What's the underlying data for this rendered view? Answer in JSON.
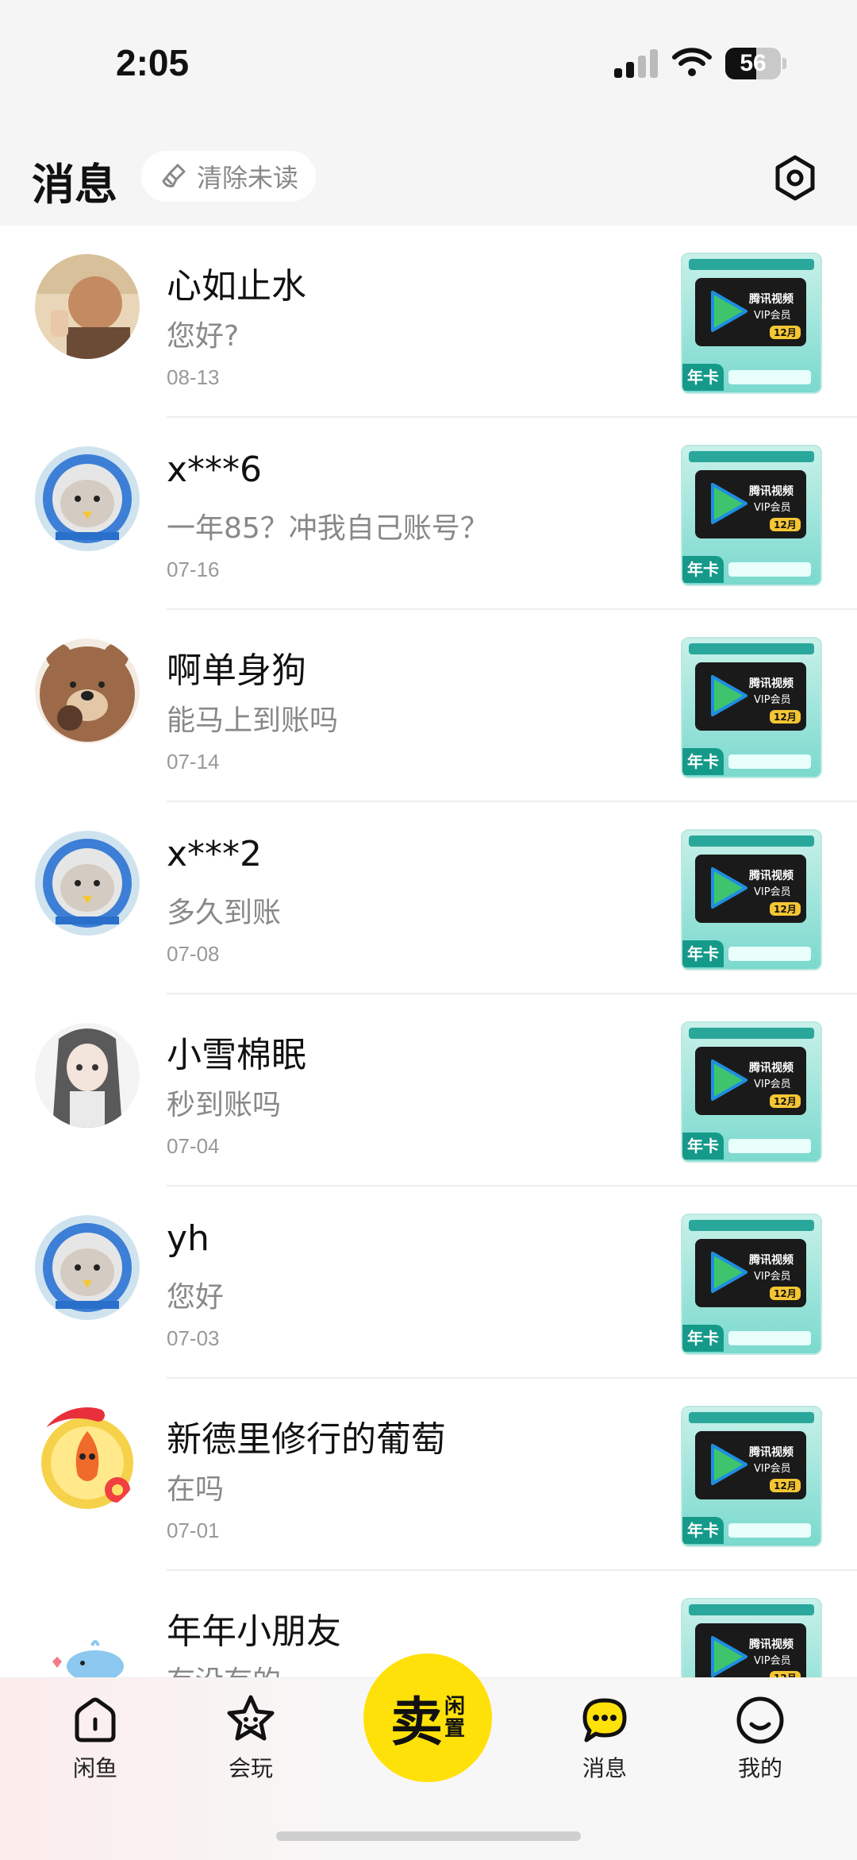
{
  "status_bar": {
    "time": "2:05",
    "battery": "56",
    "battery_level": 0.56
  },
  "header": {
    "title": "消息",
    "clear_unread_label": "清除未读"
  },
  "conversations": [
    {
      "name": "心如止水",
      "preview": "您好?",
      "date": "08-13",
      "avatar": "person-photo"
    },
    {
      "name": "x***6",
      "preview": "一年85？冲我自己账号？",
      "date": "07-16",
      "avatar": "cat-astronaut"
    },
    {
      "name": "啊单身狗",
      "preview": "能马上到账吗",
      "date": "07-14",
      "avatar": "brown-bear"
    },
    {
      "name": "x***2",
      "preview": "多久到账",
      "date": "07-08",
      "avatar": "cat-astronaut"
    },
    {
      "name": "小雪棉眠",
      "preview": "秒到账吗",
      "date": "07-04",
      "avatar": "anime-girl"
    },
    {
      "name": "yh",
      "preview": "您好",
      "date": "07-03",
      "avatar": "cat-astronaut"
    },
    {
      "name": "新德里修行的葡萄",
      "preview": "在吗",
      "date": "07-01",
      "avatar": "little-red-flower"
    },
    {
      "name": "年年小朋友",
      "preview": "有没有的",
      "date": "",
      "avatar": "blue-whale"
    }
  ],
  "product_card": {
    "line1": "腾讯视频",
    "line2": "VIP会员",
    "duration": "12月",
    "tag": "年卡"
  },
  "tab_bar": {
    "tabs": [
      {
        "label": "闲鱼",
        "icon": "home-icon"
      },
      {
        "label": "会玩",
        "icon": "star-face-icon"
      },
      {
        "label": "消息",
        "icon": "chat-bubble-icon"
      },
      {
        "label": "我的",
        "icon": "smile-face-icon"
      }
    ],
    "sell": {
      "main": "卖",
      "sub_top": "闲",
      "sub_bottom": "置"
    }
  },
  "colors": {
    "accent_yellow": "#ffe10a",
    "muted_text": "#888888",
    "background": "#f5f5f5"
  }
}
